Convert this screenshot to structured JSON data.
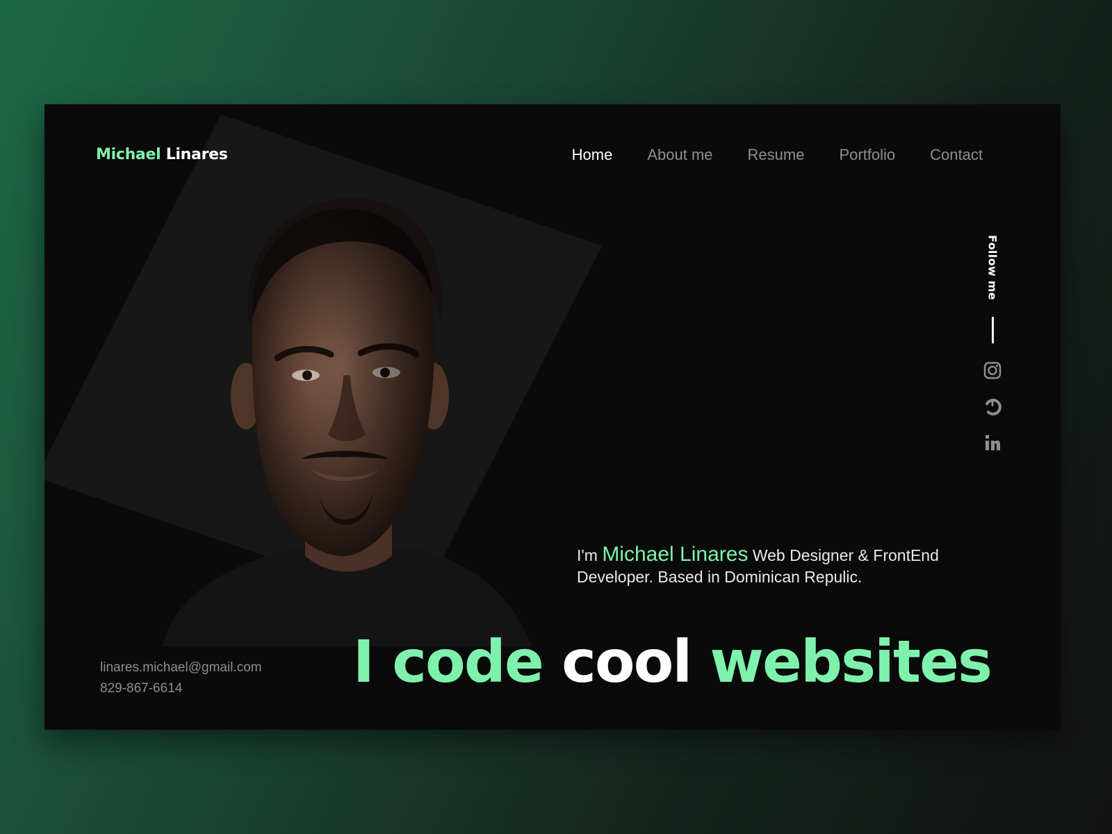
{
  "logo": {
    "first": "Michael",
    "last": "Linares"
  },
  "nav": {
    "items": [
      {
        "label": "Home",
        "active": true
      },
      {
        "label": "About me",
        "active": false
      },
      {
        "label": "Resume",
        "active": false
      },
      {
        "label": "Portfolio",
        "active": false
      },
      {
        "label": "Contact",
        "active": false
      }
    ]
  },
  "follow": {
    "label": "Follow me",
    "icons": [
      "instagram-icon",
      "dribbble-icon",
      "linkedin-icon"
    ]
  },
  "intro": {
    "prefix": "I'm",
    "name": "Michael Linares",
    "line1_rest": "Web Designer & FrontEnd",
    "line2": "Developer. Based in Dominican Repulic."
  },
  "contact": {
    "email": "linares.michael@gmail.com",
    "phone": "829-867-6614"
  },
  "headline": {
    "word1": "I",
    "word2": "code",
    "word3": "cool",
    "word4": "websites"
  },
  "colors": {
    "accent": "#7ef2ac",
    "background": "#0a0a0a",
    "panel": "#171717",
    "nav_inactive": "#8f8f8f"
  }
}
